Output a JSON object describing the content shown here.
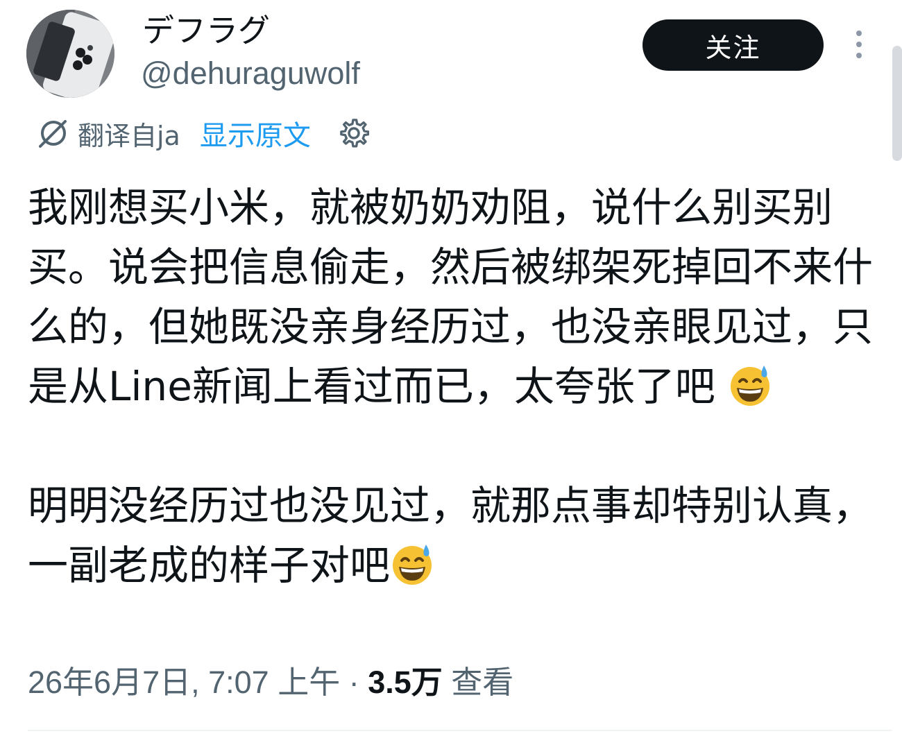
{
  "author": {
    "display_name": "デフラグ",
    "handle": "@dehuraguwolf",
    "avatar_icon": "phone-photo-avatar"
  },
  "follow_label": "关注",
  "more_icon": "vertical-ellipsis-icon",
  "translation": {
    "translated_from": "翻译自ja",
    "show_original": "显示原文",
    "icon": "translate-icon",
    "settings_icon": "gear-icon"
  },
  "tweet": {
    "paragraph1": "我刚想买小米，就被奶奶劝阻，说什么别买别买。说会把信息偷走，然后被绑架死掉回不来什么的，但她既没亲身经历过，也没亲眼见过，只是从Line新闻上看过而已，太夸张了吧",
    "paragraph2": "明明没经历过也没见过，就那点事却特别认真，一副老成的样子对吧",
    "emoji": "grinning-face-with-sweat"
  },
  "meta": {
    "timestamp": "26年6月7日, 7:07 上午",
    "separator": " · ",
    "views_count": "3.5万",
    "views_label": "查看"
  },
  "colors": {
    "text": "#0f1419",
    "secondary": "#536471",
    "link": "#1d9bf0",
    "button": "#0f1419"
  }
}
